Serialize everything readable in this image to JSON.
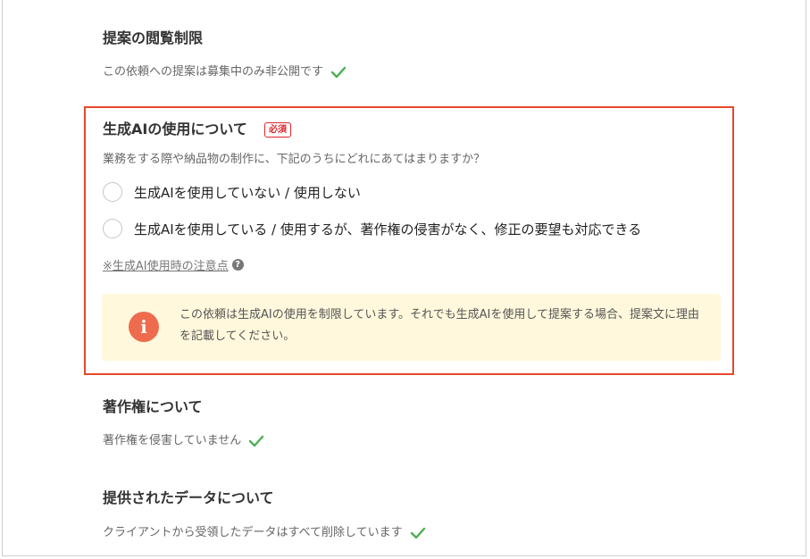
{
  "view_restriction": {
    "title": "提案の閲覧制限",
    "status": "この依頼への提案は募集中のみ非公開です"
  },
  "ai_usage": {
    "title": "生成AIの使用について",
    "required_badge": "必須",
    "question": "業務をする際や納品物の制作に、下記のうちにどれにあてはまりますか？",
    "options": [
      {
        "label": "生成AIを使用していない / 使用しない",
        "selected": false
      },
      {
        "label": "生成AIを使用している / 使用するが、著作権の侵害がなく、修正の要望も対応できる",
        "selected": false
      }
    ],
    "note_link": "※生成AI使用時の注意点",
    "notice": {
      "icon": "info-icon",
      "text": "この依頼は生成AIの使用を制限しています。それでも生成AIを使用して提案する場合、提案文に理由を記載してください。"
    }
  },
  "copyright": {
    "title": "著作権について",
    "status": "著作権を侵害していません"
  },
  "provided_data": {
    "title": "提供されたデータについて",
    "status": "クライアントから受領したデータはすべて削除しています"
  },
  "colors": {
    "check": "#4caf50",
    "required": "#e0262d",
    "highlight_border": "#e8472b",
    "notice_bg": "#fff8dc",
    "notice_icon": "#ee6b4d"
  }
}
